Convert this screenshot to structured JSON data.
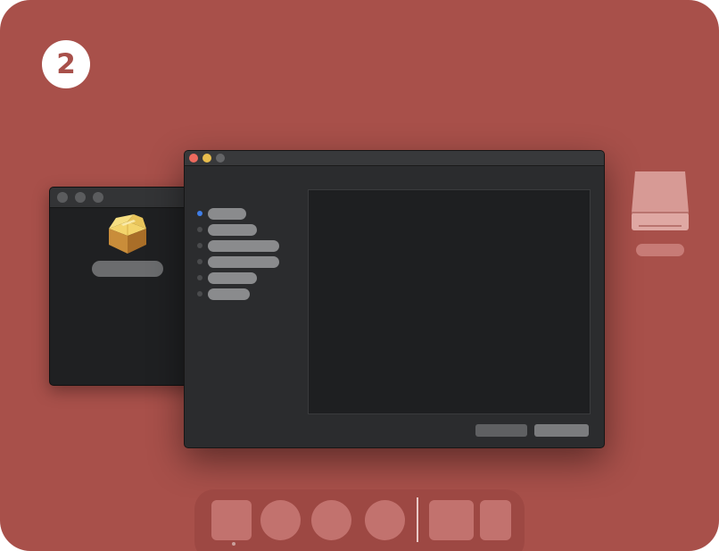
{
  "colors": {
    "background": "#a8504a",
    "badge_text": "#a8504a",
    "dock": "#9d4843",
    "close": "#ed6a5e",
    "minimize": "#e8bd4d",
    "zoom_inactive": "#646567",
    "active_step": "#3f7ee8",
    "disk_body": "#d79a95"
  },
  "step_badge": {
    "number": "2"
  },
  "back_window": {
    "icon": "package-icon",
    "label": ""
  },
  "installer": {
    "steps": [
      {
        "state": "active",
        "label": ""
      },
      {
        "state": "pending",
        "label": ""
      },
      {
        "state": "pending",
        "label": ""
      },
      {
        "state": "pending",
        "label": ""
      },
      {
        "state": "pending",
        "label": ""
      },
      {
        "state": "pending",
        "label": ""
      }
    ],
    "buttons": {
      "secondary": "",
      "primary": ""
    }
  },
  "desktop": {
    "disk_icon": "external-drive-icon",
    "disk_label": ""
  },
  "dock": {
    "items": [
      {
        "name": "dock-item-finder",
        "shape": "square"
      },
      {
        "name": "dock-item-app-2",
        "shape": "circle"
      },
      {
        "name": "dock-item-app-3",
        "shape": "circle"
      },
      {
        "name": "dock-item-app-4",
        "shape": "circle"
      },
      {
        "name": "dock-item-folder",
        "shape": "square"
      },
      {
        "name": "dock-item-trash",
        "shape": "square"
      }
    ],
    "running_indicator": "running-dot"
  }
}
